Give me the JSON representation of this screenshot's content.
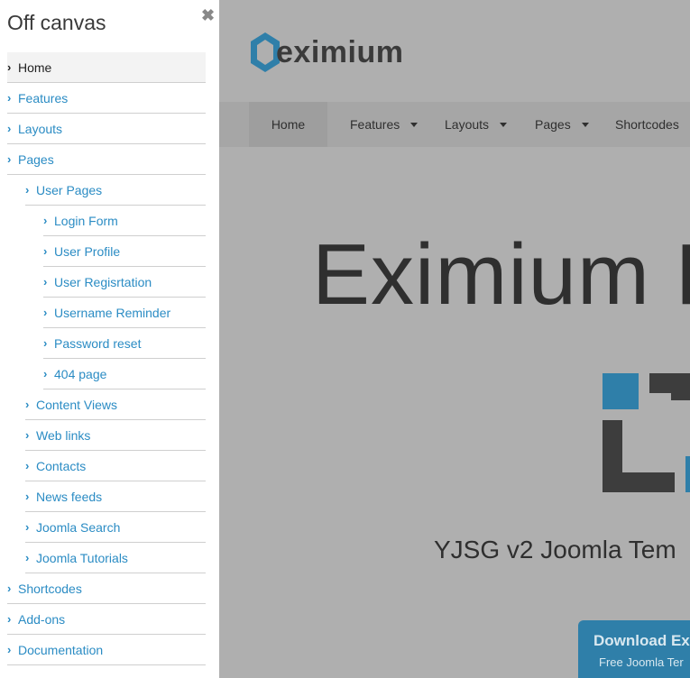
{
  "offcanvas": {
    "title": "Off canvas",
    "close_glyph": "✖",
    "items": [
      {
        "label": "Home",
        "level": 0,
        "active": true
      },
      {
        "label": "Features",
        "level": 0
      },
      {
        "label": "Layouts",
        "level": 0
      },
      {
        "label": "Pages",
        "level": 0
      },
      {
        "label": "User Pages",
        "level": 1
      },
      {
        "label": "Login Form",
        "level": 2
      },
      {
        "label": "User Profile",
        "level": 2
      },
      {
        "label": "User Regisrtation",
        "level": 2
      },
      {
        "label": "Username Reminder",
        "level": 2
      },
      {
        "label": "Password reset",
        "level": 2
      },
      {
        "label": "404 page",
        "level": 2
      },
      {
        "label": "Content Views",
        "level": 1
      },
      {
        "label": "Web links",
        "level": 1
      },
      {
        "label": "Contacts",
        "level": 1
      },
      {
        "label": "News feeds",
        "level": 1
      },
      {
        "label": "Joomla Search",
        "level": 1
      },
      {
        "label": "Joomla Tutorials",
        "level": 1
      },
      {
        "label": "Shortcodes",
        "level": 0
      },
      {
        "label": "Add-ons",
        "level": 0
      },
      {
        "label": "Documentation",
        "level": 0
      }
    ]
  },
  "site": {
    "logo_text": "eximium",
    "nav": [
      {
        "label": "Home",
        "caret": false
      },
      {
        "label": "Features",
        "caret": true
      },
      {
        "label": "Layouts",
        "caret": true
      },
      {
        "label": "Pages",
        "caret": true
      },
      {
        "label": "Shortcodes",
        "caret": false
      }
    ],
    "hero_title": "Eximium F",
    "hero_subtitle": "YJSG v2 Joomla Tem",
    "download_title": "Download Exi",
    "download_subtitle": "Free Joomla Ter"
  },
  "colors": {
    "accent": "#2b8cc4",
    "overlay": "#afafaf",
    "download_bg": "#2f7fa9",
    "logo_hex": "#2f7fa9"
  }
}
